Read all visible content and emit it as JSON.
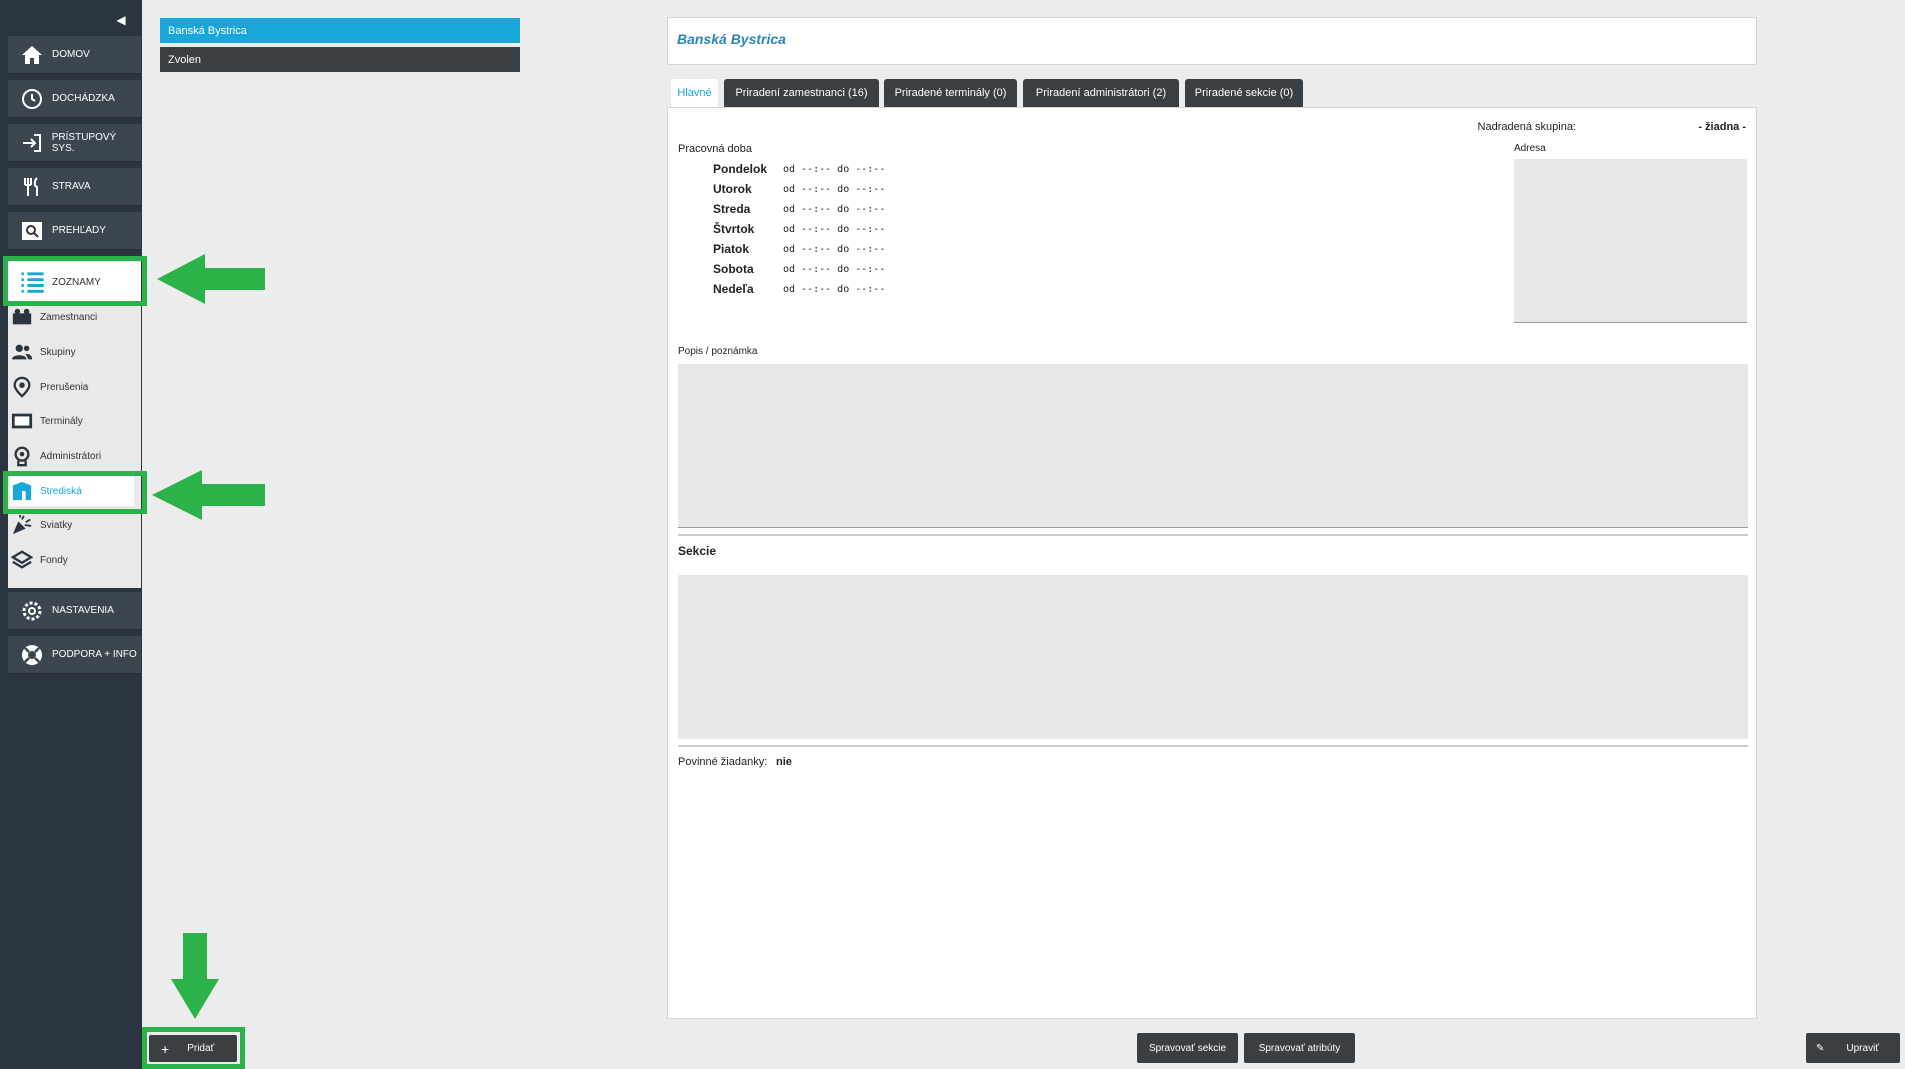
{
  "sidebar": {
    "collapse_glyph": "◀",
    "main_items": [
      {
        "label": "DOMOV",
        "icon": "home-icon"
      },
      {
        "label": "DOCHÁDZKA",
        "icon": "clock-icon"
      },
      {
        "label": "PRÍSTUPOVÝ SYS.",
        "icon": "login-icon"
      },
      {
        "label": "STRAVA",
        "icon": "cutlery-icon"
      },
      {
        "label": "PREHĽADY",
        "icon": "search-icon"
      }
    ],
    "section_label": "ZOZNAMY",
    "sub_items": [
      {
        "label": "Zamestnanci",
        "icon": "employees-icon"
      },
      {
        "label": "Skupiny",
        "icon": "group-icon"
      },
      {
        "label": "Prerušenia",
        "icon": "location-pin-icon"
      },
      {
        "label": "Terminály",
        "icon": "terminal-icon"
      },
      {
        "label": "Administrátori",
        "icon": "admin-icon"
      },
      {
        "label": "Strediská",
        "icon": "building-icon"
      },
      {
        "label": "Sviatky",
        "icon": "party-icon"
      },
      {
        "label": "Fondy",
        "icon": "layers-icon"
      }
    ],
    "bottom_items": [
      {
        "label": "NASTAVENIA",
        "icon": "gear-icon"
      },
      {
        "label": "PODPORA + INFO",
        "icon": "lifebuoy-icon"
      }
    ]
  },
  "list": {
    "items": [
      {
        "label": "Banská Bystrica",
        "selected": true
      },
      {
        "label": "Zvolen",
        "selected": false
      }
    ]
  },
  "detail": {
    "title": "Banská Bystrica",
    "tabs": [
      "Hlavné",
      "Priradení zamestnanci (16)",
      "Priradené terminály (0)",
      "Priradení administrátori (2)",
      "Priradené sekcie (0)"
    ],
    "parent_group_label": "Nadradená skupina:",
    "parent_group_value": "- žiadna -",
    "work_time_label": "Pracovná doba",
    "days": [
      "Pondelok",
      "Utorok",
      "Streda",
      "Štvrtok",
      "Piatok",
      "Sobota",
      "Nedeľa"
    ],
    "time_text": "od  --:--  do  --:--",
    "address_label": "Adresa",
    "note_label": "Popis / poznámka",
    "sections_label": "Sekcie",
    "mandatory_label": "Povinné žiadanky:",
    "mandatory_value": "nie"
  },
  "buttons": {
    "add": "Pridať",
    "manage_sections": "Spravovať sekcie",
    "manage_attributes": "Spravovať atribúty",
    "edit": "Upraviť"
  },
  "colors": {
    "accent": "#18a7d8",
    "highlight": "#2bb34a",
    "sidebar": "#2b3540"
  }
}
